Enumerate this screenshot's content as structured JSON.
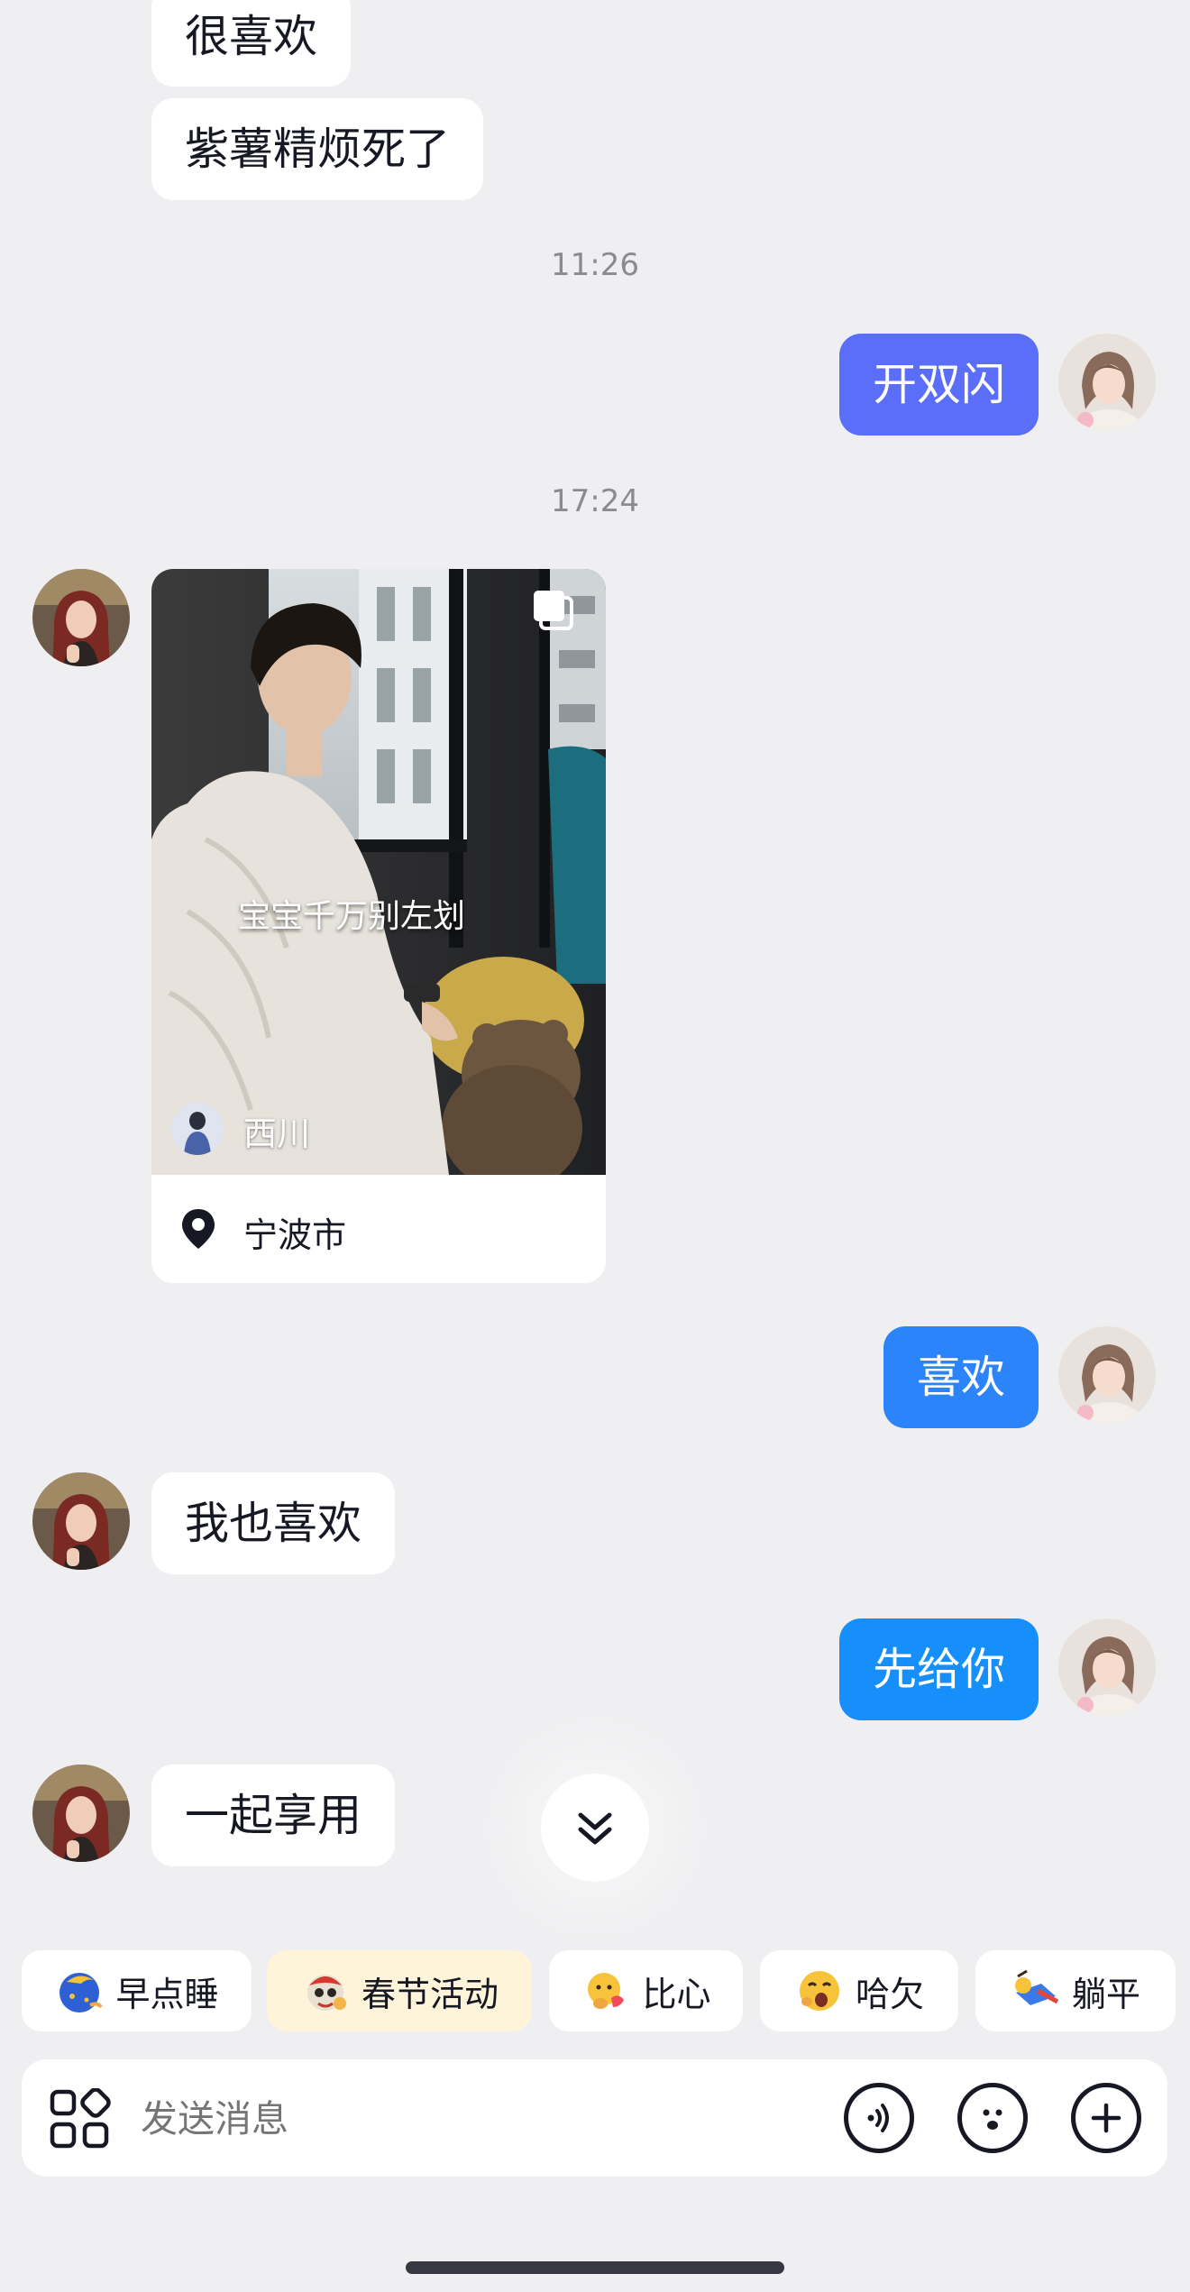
{
  "messages": {
    "m1": "很喜欢",
    "m2": "紫薯精烦死了",
    "t1": "11:26",
    "m3": "开双闪",
    "t2": "17:24",
    "m4": "喜欢",
    "m5": "我也喜欢",
    "m6": "先给你",
    "m7": "一起享用"
  },
  "video_card": {
    "caption": "宝宝千万别左划",
    "author": "西川",
    "location": "宁波市"
  },
  "quick_replies": [
    {
      "label": "早点睡",
      "icon": "moon-sleep-emoji"
    },
    {
      "label": "春节活动",
      "icon": "festival-mascot-emoji"
    },
    {
      "label": "比心",
      "icon": "heart-hands-emoji"
    },
    {
      "label": "哈欠",
      "icon": "yawn-emoji"
    },
    {
      "label": "躺平",
      "icon": "lie-flat-emoji"
    }
  ],
  "input": {
    "placeholder": "发送消息"
  },
  "colors": {
    "background": "#efeff1",
    "bubble_out_indigo": "#5b6ef9",
    "bubble_out_blue": "#2c84fa",
    "bubble_out_sky": "#178ffb",
    "bubble_in": "#ffffff",
    "highlight_chip": "#fdf4d9"
  }
}
